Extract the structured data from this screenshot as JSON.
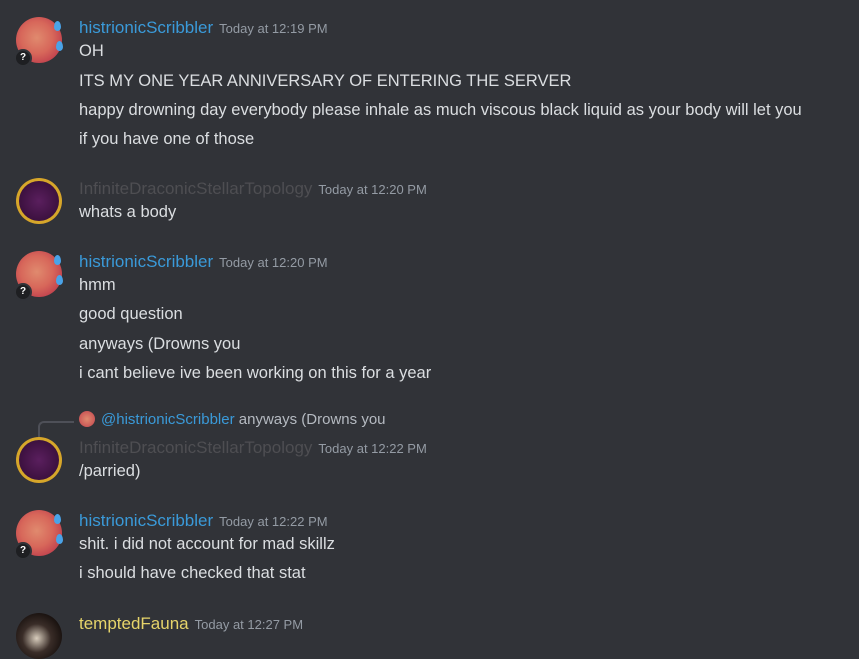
{
  "messages": [
    {
      "author": "histrionicScribbler",
      "timestamp": "Today at 12:19 PM",
      "lines": [
        "OH",
        "ITS MY ONE YEAR ANNIVERSARY OF ENTERING THE SERVER",
        "happy drowning day everybody please inhale as much viscous black liquid as your body will let you",
        "if you have one of those"
      ]
    },
    {
      "author": "InfiniteDraconicStellarTopology",
      "timestamp": "Today at 12:20 PM",
      "lines": [
        "whats a body"
      ]
    },
    {
      "author": "histrionicScribbler",
      "timestamp": "Today at 12:20 PM",
      "lines": [
        "hmm",
        "good question",
        "anyways (Drowns you",
        "i cant believe ive been working on this for a year"
      ]
    },
    {
      "reply": {
        "mention": "@histrionicScribbler",
        "text": "anyways (Drowns you"
      },
      "author": "InfiniteDraconicStellarTopology",
      "timestamp": "Today at 12:22 PM",
      "lines": [
        "/parried)"
      ]
    },
    {
      "author": "histrionicScribbler",
      "timestamp": "Today at 12:22 PM",
      "lines": [
        "shit. i did not account for mad skillz",
        "i should have checked that stat"
      ]
    },
    {
      "author": "temptedFauna",
      "timestamp": "Today at 12:27 PM",
      "lines": []
    }
  ],
  "badge": "?",
  "colors": {
    "background": "#313338",
    "histrionicScribbler": "#3a9ad9",
    "InfiniteDraconicStellarTopology": "#4e4e52",
    "temptedFauna": "#e6d46a",
    "timestamp": "#949ba4"
  }
}
